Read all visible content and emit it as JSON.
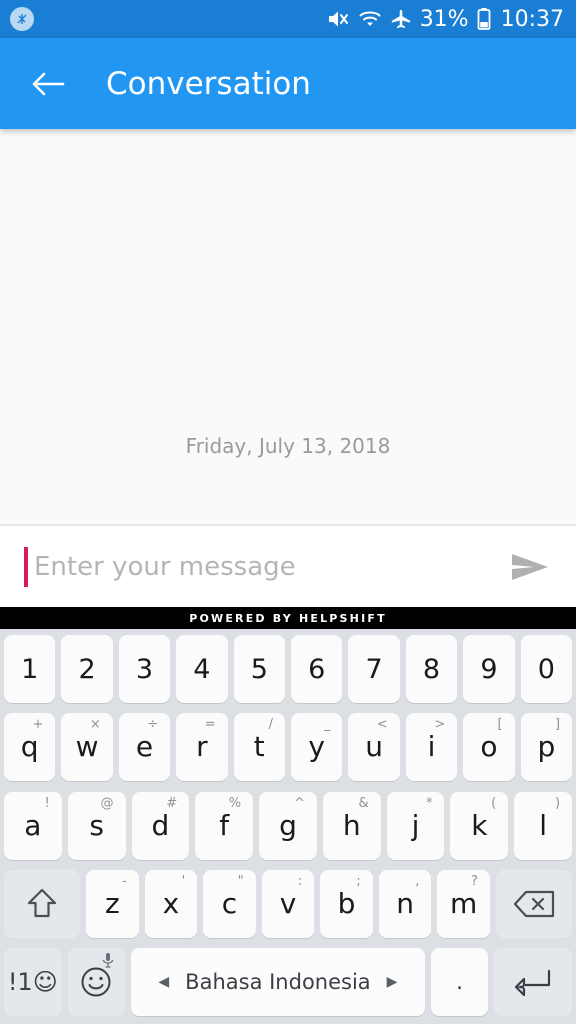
{
  "status_bar": {
    "notification_icon": "notification-badge-icon",
    "mute_icon": "volume-mute-icon",
    "wifi_icon": "wifi-icon",
    "airplane_icon": "airplane-mode-icon",
    "battery_percent": "31%",
    "battery_icon": "battery-icon",
    "time": "10:37",
    "background_color": "#1a7fd4"
  },
  "app_bar": {
    "back_icon": "back-arrow-icon",
    "title": "Conversation",
    "background_color": "#2196f3"
  },
  "conversation": {
    "date_divider": "Friday, July 13, 2018",
    "background_color": "#fafafa"
  },
  "input_bar": {
    "placeholder": "Enter your message",
    "value": "",
    "caret_color": "#d81b60",
    "send_icon": "send-arrow-icon"
  },
  "footer": {
    "branding": "POWERED BY HELPSHIFT",
    "background_color": "#000000"
  },
  "keyboard": {
    "language": "Bahasa Indonesia",
    "prev_language_arrow": "◀",
    "next_language_arrow": "▶",
    "background_color": "#dcdfe3",
    "rows": [
      {
        "name": "number-row",
        "keys": [
          {
            "main": "1",
            "sub": ""
          },
          {
            "main": "2",
            "sub": ""
          },
          {
            "main": "3",
            "sub": ""
          },
          {
            "main": "4",
            "sub": ""
          },
          {
            "main": "5",
            "sub": ""
          },
          {
            "main": "6",
            "sub": ""
          },
          {
            "main": "7",
            "sub": ""
          },
          {
            "main": "8",
            "sub": ""
          },
          {
            "main": "9",
            "sub": ""
          },
          {
            "main": "0",
            "sub": ""
          }
        ]
      },
      {
        "name": "qwerty-row",
        "keys": [
          {
            "main": "q",
            "sub": "+"
          },
          {
            "main": "w",
            "sub": "×"
          },
          {
            "main": "e",
            "sub": "÷"
          },
          {
            "main": "r",
            "sub": "="
          },
          {
            "main": "t",
            "sub": "/"
          },
          {
            "main": "y",
            "sub": "_"
          },
          {
            "main": "u",
            "sub": "<"
          },
          {
            "main": "i",
            "sub": ">"
          },
          {
            "main": "o",
            "sub": "["
          },
          {
            "main": "p",
            "sub": "]"
          }
        ]
      },
      {
        "name": "home-row",
        "keys": [
          {
            "main": "a",
            "sub": "!"
          },
          {
            "main": "s",
            "sub": "@"
          },
          {
            "main": "d",
            "sub": "#"
          },
          {
            "main": "f",
            "sub": "%"
          },
          {
            "main": "g",
            "sub": "^"
          },
          {
            "main": "h",
            "sub": "&"
          },
          {
            "main": "j",
            "sub": "*"
          },
          {
            "main": "k",
            "sub": "("
          },
          {
            "main": "l",
            "sub": ")"
          }
        ]
      },
      {
        "name": "bottom-letter-row",
        "keys": [
          {
            "main": "z",
            "sub": "-"
          },
          {
            "main": "x",
            "sub": "'"
          },
          {
            "main": "c",
            "sub": "\""
          },
          {
            "main": "v",
            "sub": ":"
          },
          {
            "main": "b",
            "sub": ";"
          },
          {
            "main": "n",
            "sub": ","
          },
          {
            "main": "m",
            "sub": "?"
          }
        ]
      }
    ],
    "shift_icon": "shift-arrow-icon",
    "backspace_icon": "backspace-delete-icon",
    "symbols_key_label": "!1☺",
    "emoji_icon": "emoji-smiley-icon",
    "mic_icon": "microphone-icon",
    "period_key_label": ".",
    "enter_icon": "enter-return-icon"
  }
}
